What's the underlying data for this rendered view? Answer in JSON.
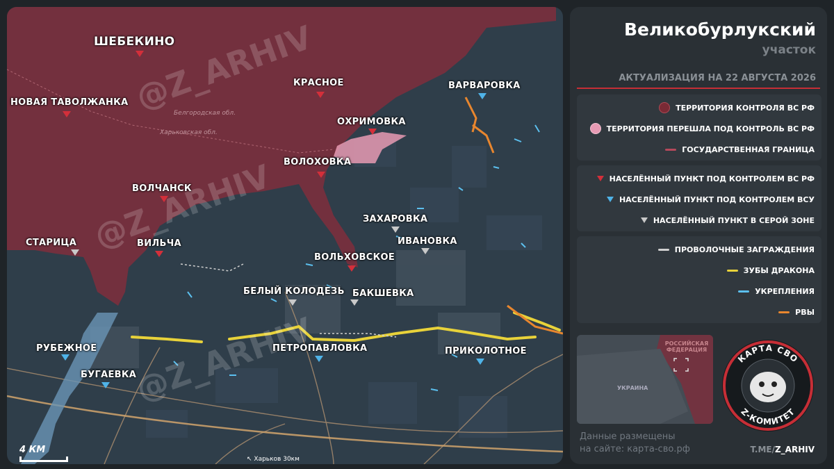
{
  "header": {
    "title": "Великобурлукский",
    "subtitle": "участок",
    "update": "АКТУАЛИЗАЦИЯ НА 22 АВГУСТА 2026"
  },
  "legend": {
    "areas": [
      {
        "label": "ТЕРРИТОРИЯ КОНТРОЛЯ ВС РФ",
        "color": "#7a2a35"
      },
      {
        "label": "ТЕРРИТОРИЯ ПЕРЕШЛА ПОД КОНТРОЛЬ ВС РФ",
        "color": "#e79ab3"
      },
      {
        "label": "ГОСУДАРСТВЕННАЯ ГРАНИЦА",
        "color": "#b5495b"
      }
    ],
    "settlements": [
      {
        "label": "НАСЕЛЁННЫЙ ПУНКТ ПОД КОНТРОЛЕМ ВС РФ",
        "color": "#d32f3a"
      },
      {
        "label": "НАСЕЛЁННЫЙ ПУНКТ ПОД КОНТРОЛЕМ ВСУ",
        "color": "#4fb3e8"
      },
      {
        "label": "НАСЕЛЁННЫЙ ПУНКТ В СЕРОЙ ЗОНЕ",
        "color": "#c9c9c9"
      }
    ],
    "defenses": [
      {
        "label": "ПРОВОЛОЧНЫЕ ЗАГРАЖДЕНИЯ",
        "color": "#d0d0d0"
      },
      {
        "label": "ЗУБЫ ДРАКОНА",
        "color": "#e8d23a"
      },
      {
        "label": "УКРЕПЛЕНИЯ",
        "color": "#5cc0ef"
      },
      {
        "label": "РВЫ",
        "color": "#e8862e"
      }
    ]
  },
  "map": {
    "places": [
      {
        "name": "ШЕБЕКИНО",
        "status": "ru"
      },
      {
        "name": "НОВАЯ ТАВОЛЖАНКА",
        "status": "ru"
      },
      {
        "name": "КРАСНОЕ",
        "status": "ru"
      },
      {
        "name": "ВАРВАРОВКА",
        "status": "ua"
      },
      {
        "name": "ОХРИМОВКА",
        "status": "ru"
      },
      {
        "name": "ВОЛОХОВКА",
        "status": "ru"
      },
      {
        "name": "ВОЛЧАНСК",
        "status": "ru"
      },
      {
        "name": "ЗАХАРОВКА",
        "status": "gray"
      },
      {
        "name": "ИВАНОВКА",
        "status": "gray"
      },
      {
        "name": "СТАРИЦА",
        "status": "gray"
      },
      {
        "name": "ВИЛЬЧА",
        "status": "ru"
      },
      {
        "name": "ВОЛЬХОВСКОЕ",
        "status": "ru"
      },
      {
        "name": "БЕЛЫЙ КОЛОДЕЗЬ",
        "status": "gray"
      },
      {
        "name": "БАКШЕВКА",
        "status": "gray"
      },
      {
        "name": "РУБЕЖНОЕ",
        "status": "ua"
      },
      {
        "name": "ПЕТРОПАВЛОВКА",
        "status": "ua"
      },
      {
        "name": "ПРИКОЛОТНОЕ",
        "status": "ua"
      },
      {
        "name": "БУГАЕВКА",
        "status": "ua"
      }
    ],
    "regions": [
      "Белгородская обл.",
      "Харьковская обл."
    ],
    "watermark": "@Z_ARHIV",
    "scale": "4 КМ",
    "direction": "Харьков 30км"
  },
  "inset": {
    "russia": "РОССИЙСКАЯ ФЕДЕРАЦИЯ",
    "ukraine": "УКРАИНА"
  },
  "logo": {
    "top": "КАРТА СВО",
    "bottom": "Z-КОМИТЕТ"
  },
  "footer": {
    "site_line1": "Данные размещены",
    "site_line2": "на сайте: карта-сво.рф",
    "tme_prefix": "T.ME/",
    "tme_handle": "Z_ARHIV"
  }
}
